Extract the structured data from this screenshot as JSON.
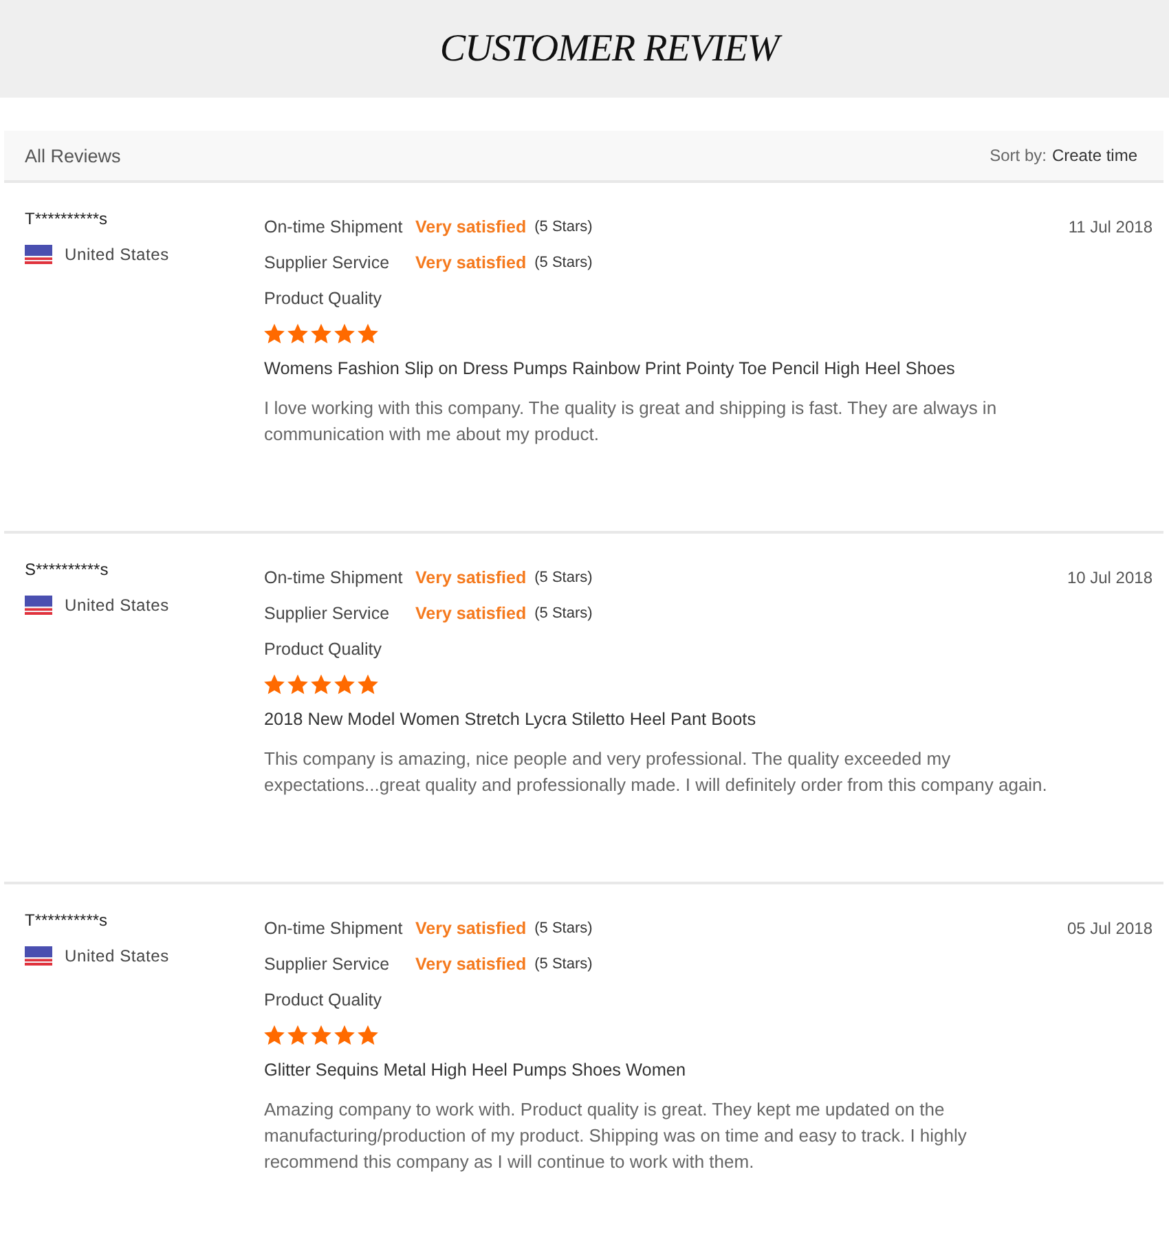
{
  "header": {
    "title": "CUSTOMER REVIEW"
  },
  "toolbar": {
    "label": "All Reviews",
    "sort_label": "Sort by:",
    "sort_value": "Create time"
  },
  "reviews": [
    {
      "reviewer": "T**********s",
      "country": "United States",
      "date": "11 Jul 2018",
      "ratings": [
        {
          "label": "On-time Shipment",
          "verdict": "Very satisfied",
          "stars_text": "(5 Stars)"
        },
        {
          "label": "Supplier Service",
          "verdict": "Very satisfied",
          "stars_text": "(5 Stars)"
        }
      ],
      "quality_label": "Product Quality",
      "stars": 5,
      "product": "Womens Fashion Slip on Dress Pumps Rainbow Print Pointy Toe Pencil High Heel Shoes",
      "comment": "I love working with this company. The quality is great and shipping is fast. They are always in communication with me about my product."
    },
    {
      "reviewer": "S**********s",
      "country": "United States",
      "date": "10 Jul 2018",
      "ratings": [
        {
          "label": "On-time Shipment",
          "verdict": "Very satisfied",
          "stars_text": "(5 Stars)"
        },
        {
          "label": "Supplier Service",
          "verdict": "Very satisfied",
          "stars_text": "(5 Stars)"
        }
      ],
      "quality_label": "Product Quality",
      "stars": 5,
      "product": "2018 New Model Women Stretch Lycra Stiletto Heel Pant Boots",
      "comment": "This company is amazing, nice people and very professional. The quality exceeded my expectations...great quality and professionally made. I will definitely order from this company again."
    },
    {
      "reviewer": "T**********s",
      "country": "United States",
      "date": "05 Jul 2018",
      "ratings": [
        {
          "label": "On-time Shipment",
          "verdict": "Very satisfied",
          "stars_text": "(5 Stars)"
        },
        {
          "label": "Supplier Service",
          "verdict": "Very satisfied",
          "stars_text": "(5 Stars)"
        }
      ],
      "quality_label": "Product Quality",
      "stars": 5,
      "product": "Glitter Sequins Metal High Heel Pumps Shoes Women",
      "comment": "Amazing company to work with. Product quality is great. They kept me updated on the manufacturing/production of my product. Shipping was on time and easy to track. I highly recommend this company as I will continue to work with them."
    }
  ]
}
